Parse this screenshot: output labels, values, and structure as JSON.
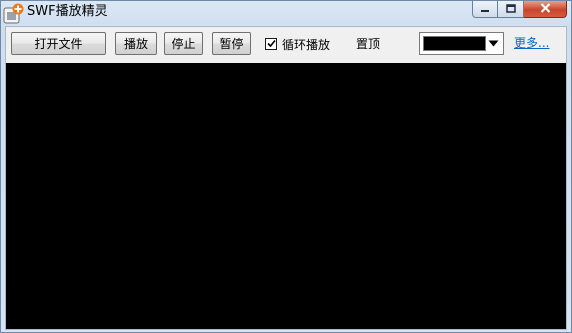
{
  "window": {
    "title": "SWF播放精灵"
  },
  "toolbar": {
    "open_file_label": "打开文件",
    "play_label": "播放",
    "stop_label": "停止",
    "pause_label": "暂停",
    "loop_label": "循环播放",
    "loop_checked": true,
    "topmost_label": "置顶",
    "bg_color": "#000000",
    "more_label": "更多..."
  },
  "stage": {
    "background": "#000000"
  },
  "icons": {
    "app": "app-plus-icon",
    "minimize": "minimize-icon",
    "maximize": "maximize-icon",
    "close": "close-icon",
    "dropdown": "chevron-down-icon",
    "check": "checkmark-icon"
  }
}
